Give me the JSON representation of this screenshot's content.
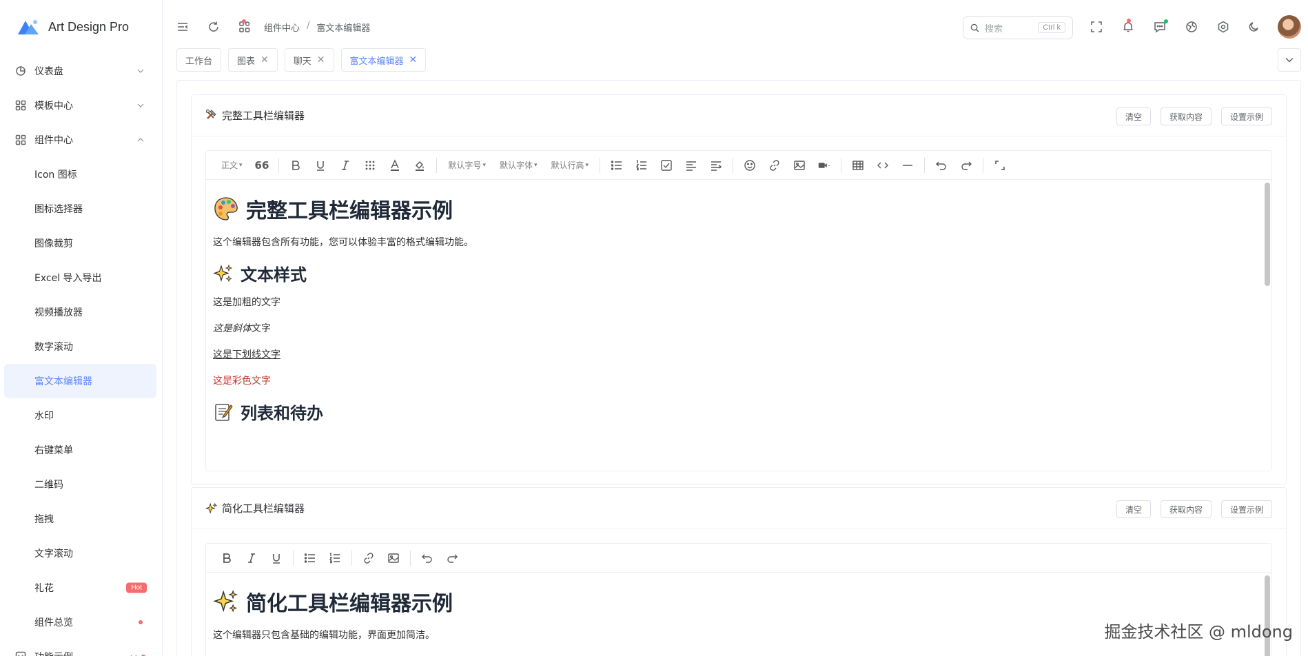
{
  "brand": {
    "name": "Art Design Pro"
  },
  "sidebar": {
    "groups": [
      {
        "label": "仪表盘",
        "icon": "dashboard-icon",
        "expanded": false
      },
      {
        "label": "模板中心",
        "icon": "grid-icon",
        "expanded": false
      },
      {
        "label": "组件中心",
        "icon": "grid-icon",
        "expanded": true
      }
    ],
    "sub_items": [
      {
        "label": "Icon 图标"
      },
      {
        "label": "图标选择器"
      },
      {
        "label": "图像裁剪"
      },
      {
        "label": "Excel 导入导出"
      },
      {
        "label": "视频播放器"
      },
      {
        "label": "数字滚动"
      },
      {
        "label": "富文本编辑器",
        "active": true
      },
      {
        "label": "水印"
      },
      {
        "label": "右键菜单"
      },
      {
        "label": "二维码"
      },
      {
        "label": "拖拽"
      },
      {
        "label": "文字滚动"
      },
      {
        "label": "礼花",
        "badge": "Hot"
      },
      {
        "label": "组件总览",
        "dot": true
      }
    ],
    "last_group": {
      "label": "功能示例",
      "icon": "code-icon"
    }
  },
  "header": {
    "breadcrumb": [
      "组件中心",
      "富文本编辑器"
    ],
    "search": {
      "placeholder": "搜索",
      "shortcut": "Ctrl k"
    }
  },
  "tabs": [
    {
      "label": "工作台",
      "closable": false
    },
    {
      "label": "图表",
      "closable": true
    },
    {
      "label": "聊天",
      "closable": true
    },
    {
      "label": "富文本编辑器",
      "closable": true,
      "active": true
    }
  ],
  "cards": {
    "full": {
      "title": "完整工具栏编辑器",
      "actions": [
        "清空",
        "获取内容",
        "设置示例"
      ],
      "toolbar": {
        "text_style": "正文",
        "font_size": "默认字号",
        "font_family": "默认字体",
        "line_height": "默认行高"
      },
      "content": {
        "h1": "完整工具栏编辑器示例",
        "intro": "这个编辑器包含所有功能，您可以体验丰富的格式编辑功能。",
        "h2_styles": "文本样式",
        "bold": "这是加粗的文字",
        "italic_prefix": "这是",
        "italic_word": "斜体",
        "italic_suffix": "文字",
        "underline": "这是下划线文字",
        "colored": "这是彩色文字",
        "h2_lists": "列表和待办"
      }
    },
    "simple": {
      "title": "简化工具栏编辑器",
      "actions": [
        "清空",
        "获取内容",
        "设置示例"
      ],
      "content": {
        "h1": "简化工具栏编辑器示例",
        "intro": "这个编辑器只包含基础的编辑功能，界面更加简洁。"
      }
    }
  },
  "watermark": "掘金技术社区 @ mldong",
  "colors": {
    "accent": "#5d87ff",
    "active_bg": "#eef3fe",
    "hot": "#f56c6c",
    "colored_text": "#c0392b"
  }
}
